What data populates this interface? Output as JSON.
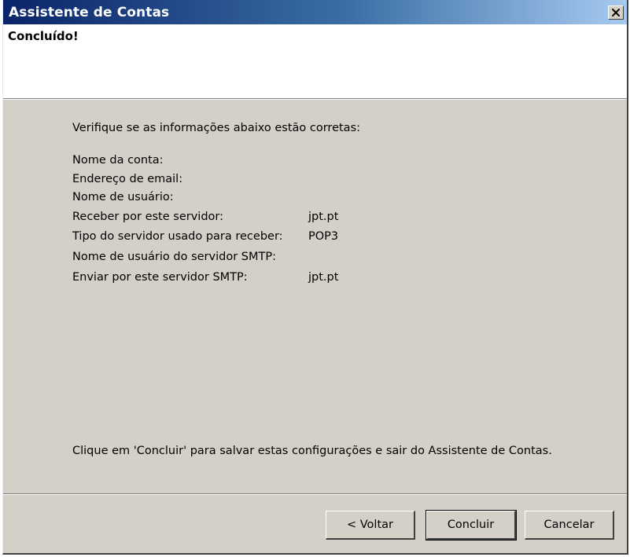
{
  "window": {
    "title": "Assistente de Contas",
    "close_glyph": "×"
  },
  "header": {
    "title": "Concluído!"
  },
  "main": {
    "intro": "Verifique se as informações abaixo estão corretas:",
    "rows": [
      {
        "label": "Nome da conta:",
        "value": ""
      },
      {
        "label": "Endereço de email:",
        "value": ""
      },
      {
        "label": "Nome de usuário:",
        "value": ""
      },
      {
        "label": "Receber por este servidor:",
        "value": "jpt.pt"
      },
      {
        "label": "Tipo do servidor usado para receber:",
        "value": "POP3"
      },
      {
        "label": "Nome de usuário do servidor SMTP:",
        "value": ""
      },
      {
        "label": "Enviar por este servidor SMTP:",
        "value": "jpt.pt"
      }
    ],
    "footer_note": "Clique em 'Concluir' para salvar estas configurações e sair do Assistente de Contas."
  },
  "buttons": {
    "back": "< Voltar",
    "finish": "Concluir",
    "cancel": "Cancelar"
  }
}
